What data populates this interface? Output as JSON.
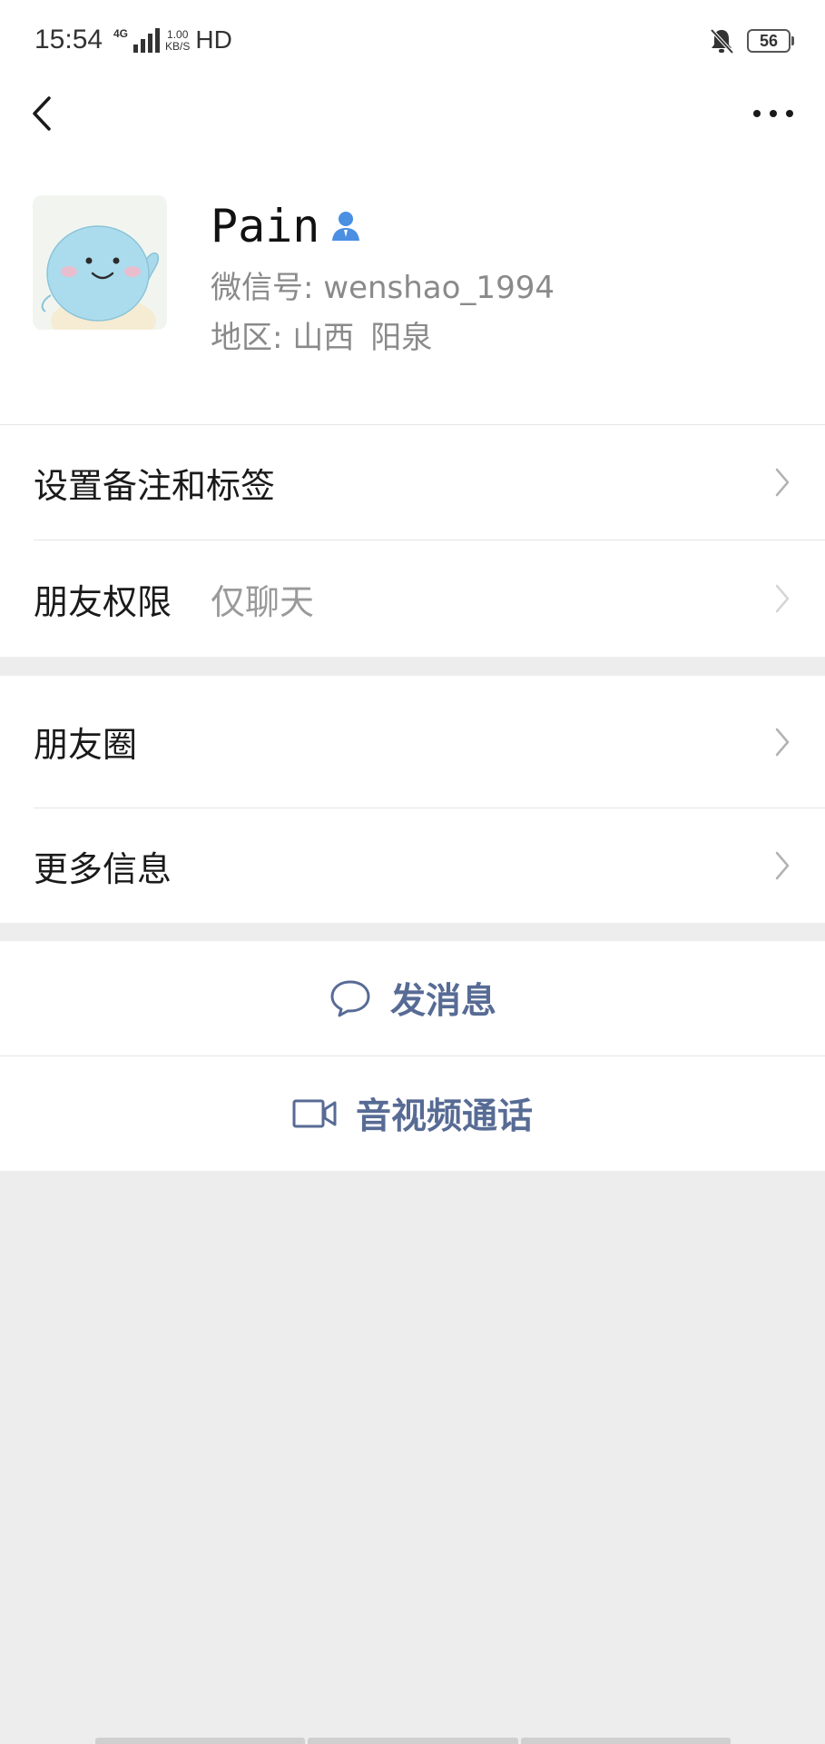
{
  "status_bar": {
    "time": "15:54",
    "network": "4G",
    "speed_value": "1.00",
    "speed_unit": "KB/S",
    "hd": "HD",
    "battery": "56"
  },
  "nav": {
    "back_icon": "chevron-left-icon",
    "more_icon": "more-dots-icon"
  },
  "profile": {
    "name": "Pain",
    "wechat_id": "微信号: wenshao_1994",
    "region_prefix": "地区: 山西",
    "region_city": "阳泉"
  },
  "section1": {
    "set_remark": "设置备注和标签",
    "friend_permission": "朋友权限",
    "friend_permission_value": "仅聊天"
  },
  "section2": {
    "moments": "朋友圈",
    "more_info": "更多信息"
  },
  "actions": {
    "send_message": "发消息",
    "video_call": "音视频通话"
  },
  "colors": {
    "accent": "#576b95",
    "background": "#ededed",
    "verified": "#4a8fe2"
  }
}
